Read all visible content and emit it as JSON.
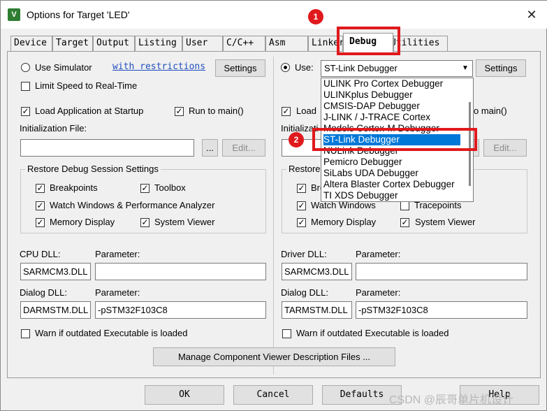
{
  "window": {
    "title": "Options for Target 'LED'",
    "icon": "V"
  },
  "tabs": [
    {
      "label": "Device"
    },
    {
      "label": "Target"
    },
    {
      "label": "Output"
    },
    {
      "label": "Listing"
    },
    {
      "label": "User"
    },
    {
      "label": "C/C++"
    },
    {
      "label": "Asm"
    },
    {
      "label": "Linker"
    },
    {
      "label": "Debug"
    },
    {
      "label": "Utilities"
    }
  ],
  "left": {
    "use_simulator_label": "Use Simulator",
    "with_restrictions_link": "with restrictions",
    "settings_button": "Settings",
    "limit_speed_label": "Limit Speed to Real-Time",
    "load_app_label": "Load Application at Startup",
    "run_to_main_label": "Run to main()",
    "init_file_label": "Initialization File:",
    "browse_button": "...",
    "edit_button": "Edit...",
    "restore_group_title": "Restore Debug Session Settings",
    "restore": {
      "breakpoints": "Breakpoints",
      "toolbox": "Toolbox",
      "watch_windows": "Watch Windows & Performance Analyzer",
      "memory_display": "Memory Display",
      "system_viewer": "System Viewer"
    },
    "cpu_dll_label": "CPU DLL:",
    "cpu_dll_value": "SARMCM3.DLL",
    "parameter_label": "Parameter:",
    "cpu_param_value": "",
    "dialog_dll_label": "Dialog DLL:",
    "dialog_dll_value": "DARMSTM.DLL",
    "dialog_param_value": "-pSTM32F103C8",
    "warn_label": "Warn if outdated Executable is loaded"
  },
  "right": {
    "use_label": "Use:",
    "debugger_selected": "ST-Link Debugger",
    "settings_button": "Settings",
    "load_label": "Load",
    "run_to_main_fragment": "o main()",
    "init_label_fragment": "Initializati",
    "edit_button": "Edit...",
    "browse_button": "...",
    "restore_group_fragment": "Restore",
    "restore": {
      "breakpoints_fragment": "Bre",
      "watch_windows": "Watch Windows",
      "tracepoints": "Tracepoints",
      "memory_display": "Memory Display",
      "system_viewer": "System Viewer"
    },
    "driver_dll_label": "Driver DLL:",
    "driver_dll_value": "SARMCM3.DLL",
    "parameter_label": "Parameter:",
    "driver_param_value": "",
    "dialog_dll_label": "Dialog DLL:",
    "dialog_dll_value": "TARMSTM.DLL",
    "dialog_param_value": "-pSTM32F103C8",
    "warn_label": "Warn if outdated Executable is loaded",
    "dropdown_items": [
      "ULINK Pro Cortex Debugger",
      "ULINKplus Debugger",
      "CMSIS-DAP Debugger",
      "J-LINK / J-TRACE Cortex",
      "Models Cortex-M Debugger",
      "ST-Link Debugger",
      "NULink Debugger",
      "Pemicro Debugger",
      "SiLabs UDA Debugger",
      "Altera Blaster Cortex Debugger",
      "TI XDS Debugger"
    ]
  },
  "manage_button": "Manage Component Viewer Description Files ...",
  "footer": {
    "ok": "OK",
    "cancel": "Cancel",
    "defaults": "Defaults",
    "help": "Help"
  },
  "annotations": {
    "badge1": "1",
    "badge2": "2"
  },
  "watermark": "CSDN @辰哥单片机设计",
  "colors": {
    "highlight_red": "#e0191c",
    "selection_blue": "#0078d7",
    "link_blue": "#1f4fbf"
  }
}
